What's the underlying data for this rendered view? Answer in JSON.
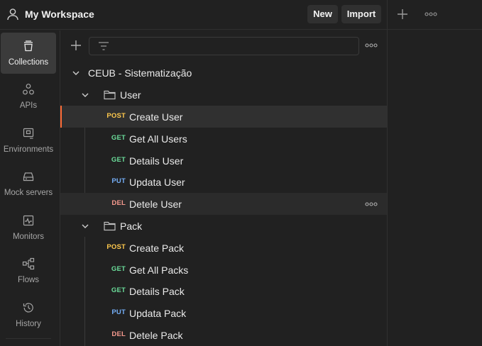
{
  "header": {
    "workspace_title": "My Workspace",
    "new_label": "New",
    "import_label": "Import"
  },
  "sidebar": {
    "items": [
      {
        "label": "Collections",
        "icon": "collections-icon",
        "active": true
      },
      {
        "label": "APIs",
        "icon": "apis-icon"
      },
      {
        "label": "Environments",
        "icon": "environments-icon"
      },
      {
        "label": "Mock servers",
        "icon": "mock-servers-icon"
      },
      {
        "label": "Monitors",
        "icon": "monitors-icon"
      },
      {
        "label": "Flows",
        "icon": "flows-icon"
      },
      {
        "label": "History",
        "icon": "history-icon"
      }
    ]
  },
  "collection": {
    "name": "CEUB - Sistematização",
    "folders": [
      {
        "name": "User",
        "requests": [
          {
            "method": "POST",
            "name": "Create User",
            "selected": true
          },
          {
            "method": "GET",
            "name": "Get All Users"
          },
          {
            "method": "GET",
            "name": "Details User"
          },
          {
            "method": "PUT",
            "name": "Updata User"
          },
          {
            "method": "DEL",
            "name": "Detele User",
            "hovered": true
          }
        ]
      },
      {
        "name": "Pack",
        "requests": [
          {
            "method": "POST",
            "name": "Create Pack"
          },
          {
            "method": "GET",
            "name": "Get All Packs"
          },
          {
            "method": "GET",
            "name": "Details Pack"
          },
          {
            "method": "PUT",
            "name": "Updata Pack"
          },
          {
            "method": "DEL",
            "name": "Detele Pack"
          }
        ]
      }
    ]
  },
  "colors": {
    "POST": "#ffc94d",
    "GET": "#6bdd9a",
    "PUT": "#74aef6",
    "DEL": "#f79a8e",
    "accent": "#ff6c37"
  }
}
